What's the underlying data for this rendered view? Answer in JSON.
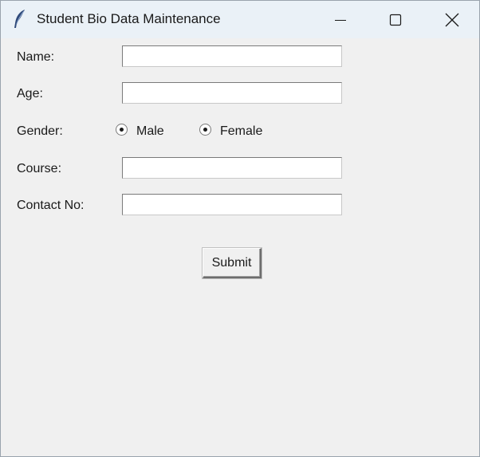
{
  "window": {
    "title": "Student Bio Data Maintenance",
    "icon": "feather-icon"
  },
  "form": {
    "name": {
      "label": "Name:",
      "value": ""
    },
    "age": {
      "label": "Age:",
      "value": ""
    },
    "gender": {
      "label": "Gender:",
      "options": [
        "Male",
        "Female"
      ],
      "selected": [
        "Male",
        "Female"
      ]
    },
    "course": {
      "label": "Course:",
      "value": ""
    },
    "contact": {
      "label": "Contact No:",
      "value": ""
    },
    "submit_label": "Submit"
  }
}
